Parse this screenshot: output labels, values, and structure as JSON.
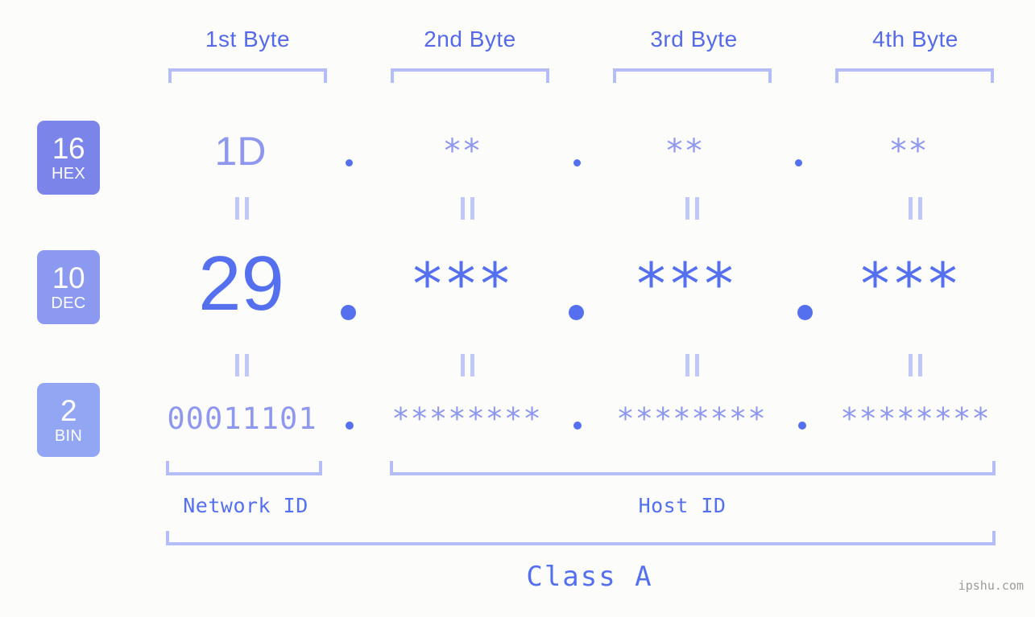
{
  "background_color": "#fcfdfa",
  "accent_color": "#5570ef",
  "accent_light_color": "#8f98ef",
  "bracket_color": "#b4bdf7",
  "byte_headers": [
    {
      "label": "1st Byte"
    },
    {
      "label": "2nd Byte"
    },
    {
      "label": "3rd Byte"
    },
    {
      "label": "4th Byte"
    }
  ],
  "bases": [
    {
      "number": "16",
      "name": "HEX",
      "color": "#7b84e8"
    },
    {
      "number": "10",
      "name": "DEC",
      "color": "#8c99f0"
    },
    {
      "number": "2",
      "name": "BIN",
      "color": "#92a6f3"
    }
  ],
  "rows": {
    "hex": {
      "values": [
        "1D",
        "**",
        "**",
        "**"
      ]
    },
    "dec": {
      "values": [
        "29",
        "***",
        "***",
        "***"
      ]
    },
    "bin": {
      "values": [
        "00011101",
        "********",
        "********",
        "********"
      ]
    }
  },
  "separators": {
    "glyph": "."
  },
  "equals_glyph": "=",
  "id_labels": [
    {
      "label": "Network ID"
    },
    {
      "label": "Host ID"
    }
  ],
  "class_label": "Class A",
  "watermark": "ipshu.com"
}
